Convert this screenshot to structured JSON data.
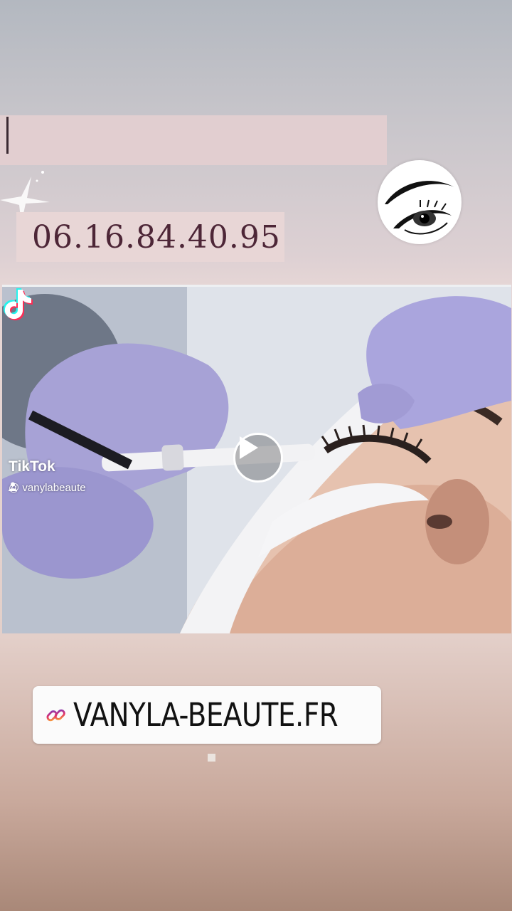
{
  "story": {
    "phone_number": "06.16.84.40.95",
    "link_sticker": {
      "icon": "link-icon",
      "label": "VANYLA-BEAUTE.FR"
    }
  },
  "video": {
    "brand": "TikTok",
    "username": "@ vanylabeaute",
    "play_icon": "play-icon"
  },
  "colors": {
    "phone_text": "#4d2637",
    "tiktok_pink": "#fe2c55",
    "tiktok_cyan": "#25f4ee"
  }
}
